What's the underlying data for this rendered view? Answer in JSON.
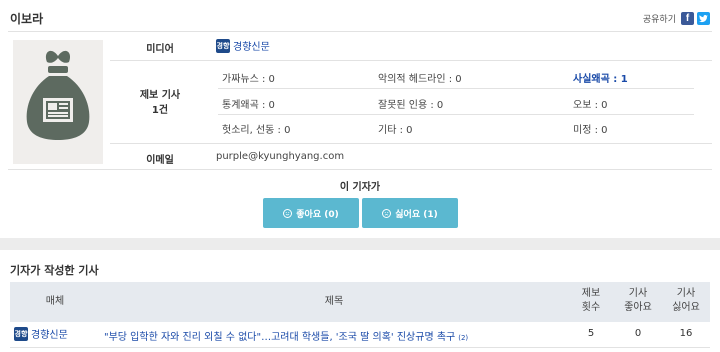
{
  "reporter": {
    "name": "이보라",
    "share_label": "공유하기",
    "facebook_glyph": "f",
    "twitter_glyph": "t"
  },
  "profile": {
    "media_label": "미디어",
    "media_name": "경향신문",
    "media_logo_text": "경향",
    "report_label_line1": "제보 기사",
    "report_label_line2": "1건",
    "email_label": "이메일",
    "email": "purple@kyunghyang.com",
    "categories": [
      {
        "label": "가짜뉴스 : 0",
        "highlight": false
      },
      {
        "label": "악의적 헤드라인 : 0",
        "highlight": false
      },
      {
        "label": "사실왜곡 : 1",
        "highlight": true
      },
      {
        "label": "통계왜곡 : 0",
        "highlight": false
      },
      {
        "label": "잘못된 인용 : 0",
        "highlight": false
      },
      {
        "label": "오보 : 0",
        "highlight": false
      },
      {
        "label": "헛소리, 선동 : 0",
        "highlight": false
      },
      {
        "label": "기타 : 0",
        "highlight": false
      },
      {
        "label": "미정 : 0",
        "highlight": false
      }
    ]
  },
  "vote": {
    "title": "이 기자가",
    "like_label": "좋아요 (0)",
    "dislike_label": "싫어요 (1)"
  },
  "articles": {
    "section_title": "기자가 작성한 기사",
    "headers": {
      "media": "매체",
      "title": "제목",
      "reports_1": "제보",
      "reports_2": "횟수",
      "likes_1": "기사",
      "likes_2": "좋아요",
      "dislikes_1": "기사",
      "dislikes_2": "싫어요"
    },
    "rows": [
      {
        "media": "경향신문",
        "media_logo_text": "경향",
        "title": "\"부당 입학한 자와 진리 외칠 수 없다\"…고려대 학생들, '조국 딸 의혹' 진상규명 촉구",
        "comment_count": "(2)",
        "reports": "5",
        "likes": "0",
        "dislikes": "16"
      }
    ]
  },
  "colors": {
    "accent": "#5bb8d0",
    "link": "#1a4aa8",
    "facebook": "#3b5998",
    "twitter": "#1da1f2"
  }
}
